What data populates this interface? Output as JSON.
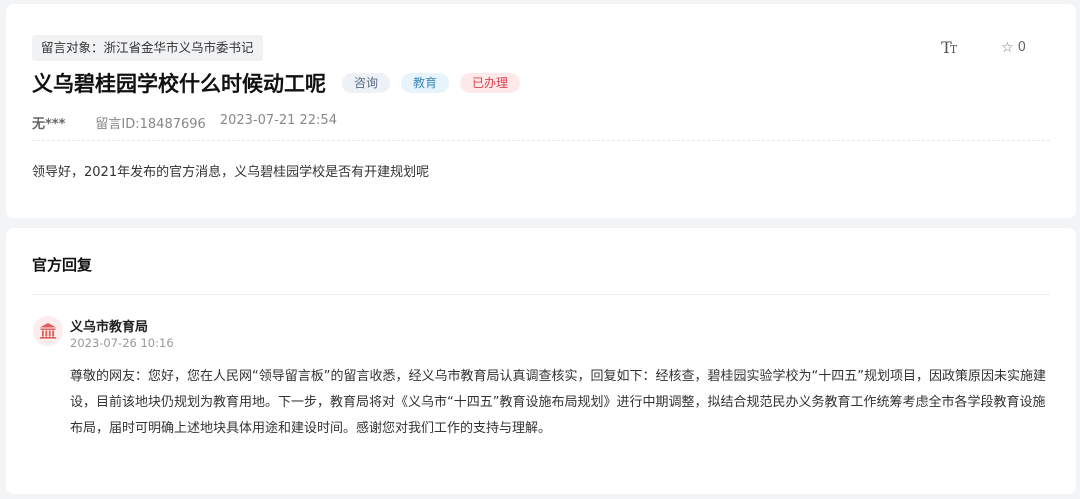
{
  "message": {
    "target_label": "留言对象：浙江省金华市义乌市委书记",
    "title": "义乌碧桂园学校什么时候动工呢",
    "tags": {
      "type": "咨询",
      "category": "教育",
      "status": "已办理"
    },
    "author": "无***",
    "message_id": "留言ID:18487696",
    "time": "2023-07-21 22:54",
    "content": "领导好，2021年发布的官方消息，义乌碧桂园学校是否有开建规划呢",
    "favorite_count": "0"
  },
  "toolbar": {
    "font_size_icon": "font-size-icon",
    "favorite_icon": "star-icon"
  },
  "reply": {
    "section_title": "官方回复",
    "org_name": "义乌市教育局",
    "org_time": "2023-07-26 10:16",
    "body": "尊敬的网友：您好，您在人民网“领导留言板”的留言收悉，经义乌市教育局认真调查核实，回复如下：经核查，碧桂园实验学校为“十四五”规划项目，因政策原因未实施建设，目前该地块仍规划为教育用地。下一步，教育局将对《义乌市“十四五”教育设施布局规划》进行中期调整，拟结合规范民办义务教育工作统筹考虑全市各学段教育设施布局，届时可明确上述地块具体用途和建设时间。感谢您对我们工作的支持与理解。"
  },
  "colors": {
    "status_red": "#e0414b",
    "category_blue": "#3b8ab8",
    "page_bg": "#f3f4f6"
  }
}
